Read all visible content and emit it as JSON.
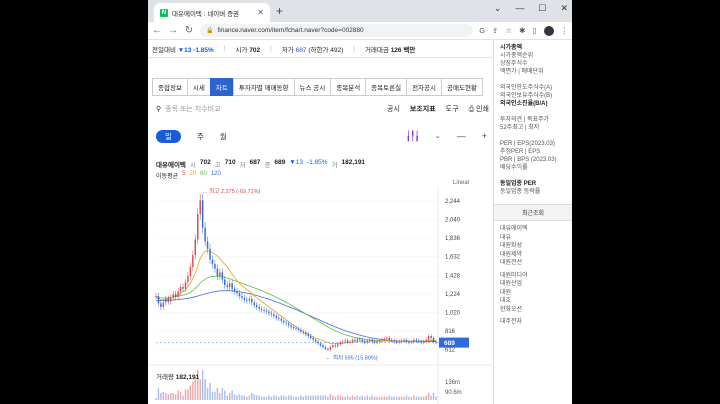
{
  "browser": {
    "tab_title": "대유에이텍 : 네이버 증권",
    "url": "finance.naver.com/item/fchart.naver?code=002880",
    "favicon_letter": "N"
  },
  "quote": {
    "prev_label": "전일대비",
    "change": "▼13",
    "change_pct": "-1.85%",
    "open_label": "시가",
    "open": "702",
    "low_label": "저가",
    "low": "687",
    "low_limit": "(하한가 492)",
    "amount_label": "거래대금",
    "amount": "126 백만"
  },
  "nav_tabs": [
    "종합정보",
    "시세",
    "차트",
    "투자자별 매매동향",
    "뉴스 공시",
    "종목분석",
    "종목토론실",
    "전자공시",
    "공매도현황"
  ],
  "active_tab": 2,
  "search": {
    "placeholder": "종목 또는 지수비교",
    "right_items": [
      "공시",
      "보조지표",
      "도구",
      "인쇄"
    ]
  },
  "periods": [
    "일",
    "주",
    "월"
  ],
  "active_period": 0,
  "info": {
    "name": "대유에이텍",
    "open_label": "시",
    "open": "702",
    "high_label": "고",
    "high": "710",
    "low_label": "저",
    "low": "687",
    "close_label": "종",
    "close": "689",
    "change": "▼13",
    "change_pct": "-1.85%",
    "volume_label": "거",
    "volume": "182,191"
  },
  "ma": {
    "label": "이동평균",
    "p5": "5",
    "p20": "20",
    "p60": "60",
    "p120": "120"
  },
  "scale_label": "Linear",
  "volume": {
    "label": "거래량",
    "value": "182,191",
    "axis_top": "136m",
    "axis_second": "90.6m"
  },
  "chart_data": {
    "type": "candlestick",
    "y_ticks": [
      2244,
      2040,
      1836,
      1632,
      1428,
      1224,
      1020,
      816,
      612
    ],
    "current_price": 689,
    "current_label": "689",
    "ylim": [
      520,
      2320
    ],
    "max_annotation": "최고 2,375 (-69.71%)",
    "min_annotation": "최저 595 (15.80%)",
    "close_series": [
      1200,
      1120,
      1080,
      1130,
      1170,
      1140,
      1180,
      1220,
      1190,
      1250,
      1300,
      1280,
      1350,
      1420,
      1520,
      1650,
      1820,
      2100,
      2250,
      1950,
      1800,
      1720,
      1600,
      1550,
      1500,
      1420,
      1460,
      1380,
      1320,
      1300,
      1340,
      1280,
      1250,
      1230,
      1200,
      1180,
      1160,
      1150,
      1170,
      1130,
      1100,
      1080,
      1060,
      1050,
      1040,
      1030,
      1010,
      1000,
      980,
      960,
      950,
      930,
      910,
      900,
      880,
      860,
      850,
      840,
      830,
      810,
      800,
      780,
      760,
      740,
      720,
      700,
      680,
      660,
      640,
      620,
      610,
      640,
      660,
      650,
      670,
      690,
      700,
      710,
      690,
      700,
      720,
      710,
      730,
      720,
      700,
      690,
      710,
      720,
      700,
      690,
      700,
      710,
      720,
      730,
      740,
      720,
      710,
      700,
      690,
      700,
      710,
      720,
      700,
      690,
      700,
      720,
      710,
      700,
      690,
      700,
      720,
      760,
      740,
      700,
      689
    ],
    "ma20": [
      1200,
      1180,
      1160,
      1160,
      1170,
      1170,
      1180,
      1190,
      1200,
      1210,
      1230,
      1250,
      1270,
      1300,
      1340,
      1390,
      1450,
      1530,
      1610,
      1660,
      1690,
      1700,
      1690,
      1680,
      1660,
      1640,
      1610,
      1580,
      1550,
      1520,
      1480,
      1440,
      1400,
      1370,
      1340,
      1310,
      1290,
      1270,
      1250,
      1230,
      1200,
      1180,
      1160,
      1140,
      1120,
      1100,
      1080,
      1060,
      1040,
      1020,
      1000,
      980,
      960,
      940,
      920,
      900,
      880,
      860,
      840,
      820,
      800,
      790,
      780,
      770,
      750,
      740,
      730,
      720,
      710,
      700,
      690,
      680,
      680,
      680,
      680,
      680,
      680,
      685,
      690,
      690,
      695,
      700,
      700,
      705,
      705,
      705,
      705,
      705,
      705,
      705,
      705,
      705,
      708,
      710,
      712,
      712,
      712,
      710,
      708,
      706,
      705,
      705,
      705,
      704,
      703,
      703,
      703,
      704,
      705,
      706,
      708,
      712,
      714,
      712,
      710
    ],
    "ma60": [
      1180,
      1180,
      1180,
      1180,
      1180,
      1180,
      1185,
      1190,
      1195,
      1200,
      1205,
      1210,
      1215,
      1225,
      1240,
      1260,
      1285,
      1310,
      1340,
      1365,
      1385,
      1400,
      1410,
      1415,
      1418,
      1418,
      1415,
      1410,
      1405,
      1398,
      1390,
      1380,
      1370,
      1360,
      1350,
      1340,
      1330,
      1320,
      1310,
      1300,
      1290,
      1280,
      1270,
      1260,
      1248,
      1236,
      1224,
      1212,
      1200,
      1186,
      1172,
      1158,
      1144,
      1130,
      1116,
      1100,
      1084,
      1068,
      1052,
      1036,
      1020,
      1004,
      988,
      972,
      956,
      940,
      924,
      908,
      892,
      876,
      860,
      846,
      832,
      820,
      808,
      796,
      786,
      776,
      768,
      760,
      752,
      746,
      740,
      735,
      730,
      726,
      722,
      719,
      716,
      714,
      712,
      710,
      709,
      708,
      707,
      706,
      705,
      704,
      703,
      702,
      702,
      702,
      702,
      702,
      702,
      702,
      702,
      703,
      703,
      704,
      705,
      706,
      707,
      707,
      707
    ],
    "ma120": [
      1150,
      1150,
      1150,
      1150,
      1152,
      1154,
      1156,
      1158,
      1160,
      1162,
      1165,
      1168,
      1171,
      1175,
      1180,
      1186,
      1193,
      1200,
      1208,
      1216,
      1224,
      1231,
      1238,
      1244,
      1249,
      1253,
      1256,
      1258,
      1259,
      1259,
      1258,
      1256,
      1253,
      1250,
      1246,
      1242,
      1237,
      1232,
      1226,
      1220,
      1213,
      1206,
      1198,
      1190,
      1182,
      1173,
      1164,
      1155,
      1146,
      1136,
      1126,
      1116,
      1106,
      1095,
      1084,
      1073,
      1062,
      1051,
      1040,
      1028,
      1016,
      1004,
      992,
      980,
      968,
      956,
      944,
      932,
      920,
      908,
      896,
      884,
      872,
      861,
      850,
      840,
      830,
      820,
      811,
      802,
      794,
      786,
      778,
      771,
      764,
      757,
      751,
      745,
      740,
      735,
      731,
      727,
      723,
      720,
      717,
      714,
      712,
      710,
      708,
      706,
      705,
      704,
      703,
      702,
      701,
      700,
      700,
      700,
      700,
      700,
      700,
      700,
      700,
      700,
      700
    ]
  },
  "sidebar": {
    "info_title": "시가총액",
    "info_items": [
      "시가총액순위",
      "상장주식수",
      "액면가 | 매매단위"
    ],
    "foreign_items": [
      "외국인한도주식수(A)",
      "외국인보유주식수(B)"
    ],
    "foreign_strong": "외국인소진율(B/A)",
    "opinion_items": [
      "투자의견 | 목표주가",
      "52주최고 | 최저"
    ],
    "per_items": [
      "PER | EPS(2023.03)",
      "추정PER | EPS",
      "PBR | BPS (2023.03)",
      "배당수익률"
    ],
    "industry_title": "동일업종 PER",
    "industry_item": "동일업종 등락률",
    "recent_title": "최근조회",
    "recent_list_a": [
      "대유에이텍",
      "대유",
      "대원화성",
      "대원제약",
      "대원전선"
    ],
    "recent_list_b": [
      "대원미디어",
      "대원산업",
      "대원",
      "대호",
      "한화오션"
    ],
    "recent_tail": "대주전자"
  }
}
